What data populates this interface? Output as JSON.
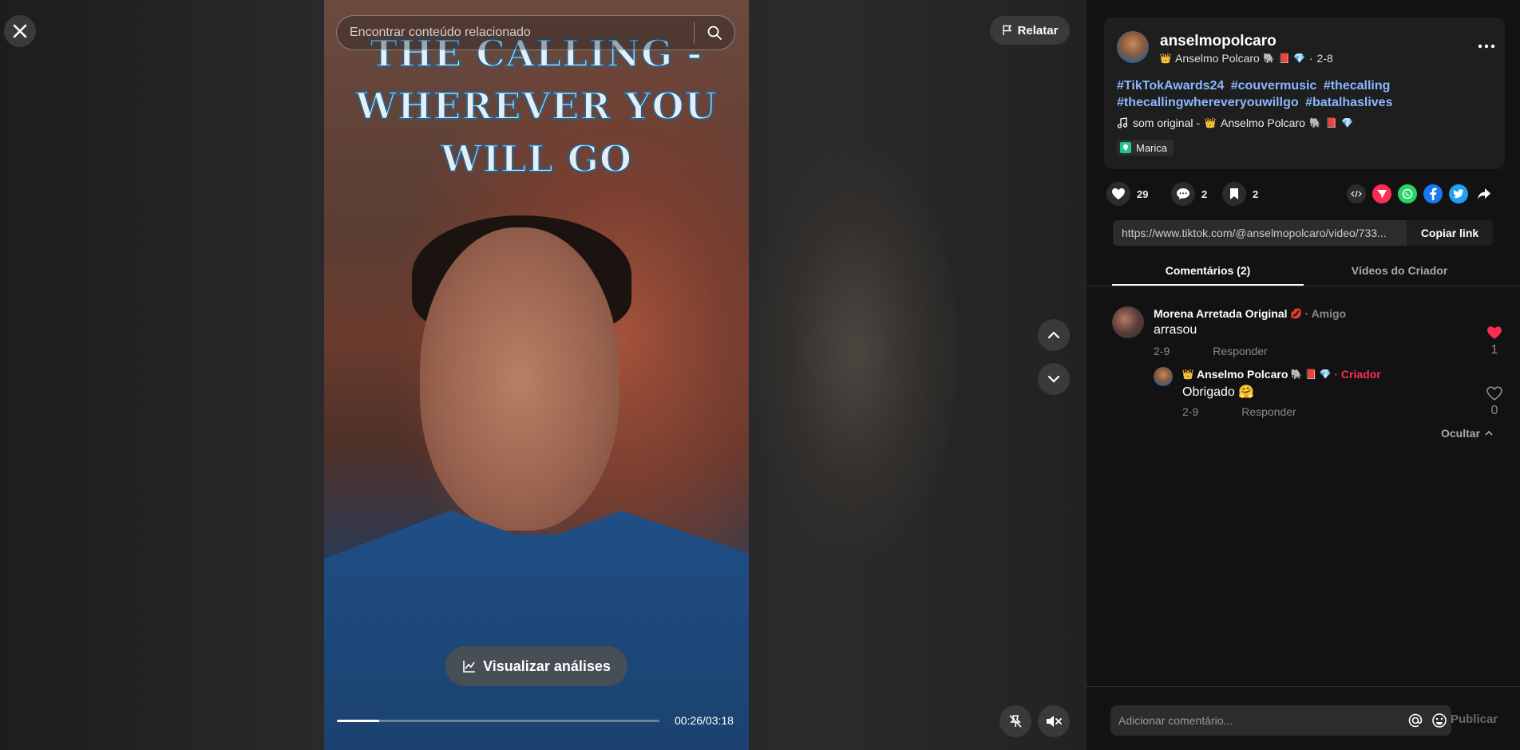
{
  "video": {
    "search_placeholder": "Encontrar conteúdo relacionado",
    "title_lines": [
      "THE CALLING -",
      "WHEREVER YOU",
      "WILL GO"
    ],
    "analytics_label": "Visualizar análises",
    "time": "00:26/03:18",
    "progress": 0.13,
    "report_label": "Relatar"
  },
  "author": {
    "username": "anselmopolcaro",
    "display_name": "Anselmo Polcaro",
    "date": "2-8",
    "hashtags": [
      "#TikTokAwards24",
      "#couvermusic",
      "#thecalling",
      "#thecallingwhereveryouwillgo",
      "#batalhaslives"
    ],
    "music": "som original -",
    "music_author": "Anselmo Polcaro",
    "location": "Marica"
  },
  "stats": {
    "likes": "29",
    "comments": "2",
    "saves": "2"
  },
  "share": {
    "link": "https://www.tiktok.com/@anselmopolcaro/video/733...",
    "copy_label": "Copiar link",
    "colors": {
      "embed": "#2c2c2c",
      "tiktok": "#fe2c55",
      "whatsapp": "#25d366",
      "facebook": "#1877f2",
      "twitter": "#1da1f2"
    }
  },
  "tabs": [
    "Comentários (2)",
    "Vídeos do Criador"
  ],
  "comments": [
    {
      "name": "Morena Arretada Original",
      "tag": "· Amigo",
      "text": "arrasou",
      "date": "2-9",
      "reply_label": "Responder",
      "likes": "1",
      "liked": true
    },
    {
      "name": "Anselmo Polcaro",
      "tag": "· Criador",
      "text": "Obrigado 🤗",
      "date": "2-9",
      "reply_label": "Responder",
      "likes": "0",
      "liked": false
    }
  ],
  "hide_label": "Ocultar",
  "composer": {
    "placeholder": "Adicionar comentário...",
    "publish_label": "Publicar"
  },
  "colors": {
    "accent": "#fe2c55",
    "hashtag": "#8ab8ff",
    "creator": "#fe2c55"
  }
}
